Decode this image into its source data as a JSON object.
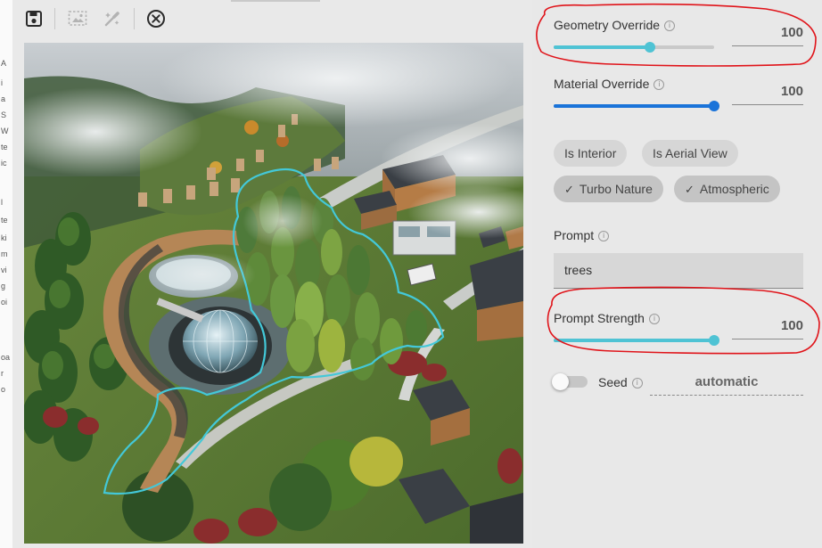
{
  "side_fragments": [
    "A",
    "i",
    "a",
    "S",
    "W",
    "te",
    "te",
    "ic",
    "",
    "l",
    "te",
    "ki",
    "m",
    "vi",
    "g",
    "oi",
    "",
    "",
    "oa",
    "r",
    "o"
  ],
  "toolbar": {
    "save_icon": "save-icon",
    "selection_icon": "image-selection-icon",
    "brush_icon": "magic-brush-icon",
    "close_icon": "close-circle-icon"
  },
  "controls": {
    "geometry": {
      "label": "Geometry Override",
      "value": "100",
      "level": 0.6,
      "color": "#4fc3d4"
    },
    "material": {
      "label": "Material Override",
      "value": "100",
      "level": 1.0,
      "color": "#1a73d9"
    },
    "chips": [
      {
        "label": "Is Interior",
        "selected": false
      },
      {
        "label": "Is Aerial View",
        "selected": false
      },
      {
        "label": "Turbo Nature",
        "selected": true
      },
      {
        "label": "Atmospheric",
        "selected": true
      }
    ],
    "check_glyph": "✓",
    "prompt": {
      "label": "Prompt",
      "value": "trees"
    },
    "prompt_strength": {
      "label": "Prompt Strength",
      "value": "100",
      "level": 1.0,
      "color": "#4fc3d4"
    },
    "seed": {
      "label": "Seed",
      "value": "automatic",
      "enabled": false
    }
  },
  "info_glyph": "i",
  "annotation_color": "#e0141a"
}
